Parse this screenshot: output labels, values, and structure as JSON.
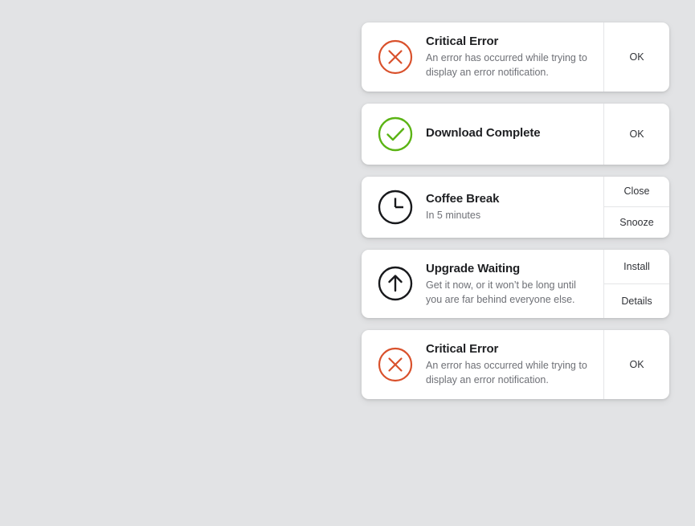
{
  "page": {
    "background_color": "#e2e3e5"
  },
  "colors": {
    "error": "#d9512c",
    "success": "#5bb415",
    "neutral": "#18191c",
    "title_text": "#1f2023",
    "body_text": "#6e7076",
    "button_text": "#313338",
    "card_background": "#ffffff",
    "divider": "#e4e5e7"
  },
  "notifications": [
    {
      "icon": "error-circle-x-icon",
      "icon_color": "#d9512c",
      "title": "Critical Error",
      "message": "An error has occurred while trying to display an error notification.",
      "actions": [
        {
          "label": "OK",
          "name": "ok-button"
        }
      ]
    },
    {
      "icon": "success-circle-check-icon",
      "icon_color": "#5bb415",
      "title": "Download Complete",
      "message": "",
      "actions": [
        {
          "label": "OK",
          "name": "ok-button"
        }
      ]
    },
    {
      "icon": "clock-icon",
      "icon_color": "#18191c",
      "title": "Coffee Break",
      "message": "In 5 minutes",
      "actions": [
        {
          "label": "Close",
          "name": "close-button"
        },
        {
          "label": "Snooze",
          "name": "snooze-button"
        }
      ]
    },
    {
      "icon": "upgrade-arrow-up-circle-icon",
      "icon_color": "#18191c",
      "title": "Upgrade Waiting",
      "message": "Get it now, or it won’t be long until you are far behind everyone else.",
      "actions": [
        {
          "label": "Install",
          "name": "install-button"
        },
        {
          "label": "Details",
          "name": "details-button"
        }
      ]
    },
    {
      "icon": "error-circle-x-icon",
      "icon_color": "#d9512c",
      "title": "Critical Error",
      "message": "An error has occurred while trying to display an error notification.",
      "actions": [
        {
          "label": "OK",
          "name": "ok-button"
        }
      ]
    }
  ]
}
